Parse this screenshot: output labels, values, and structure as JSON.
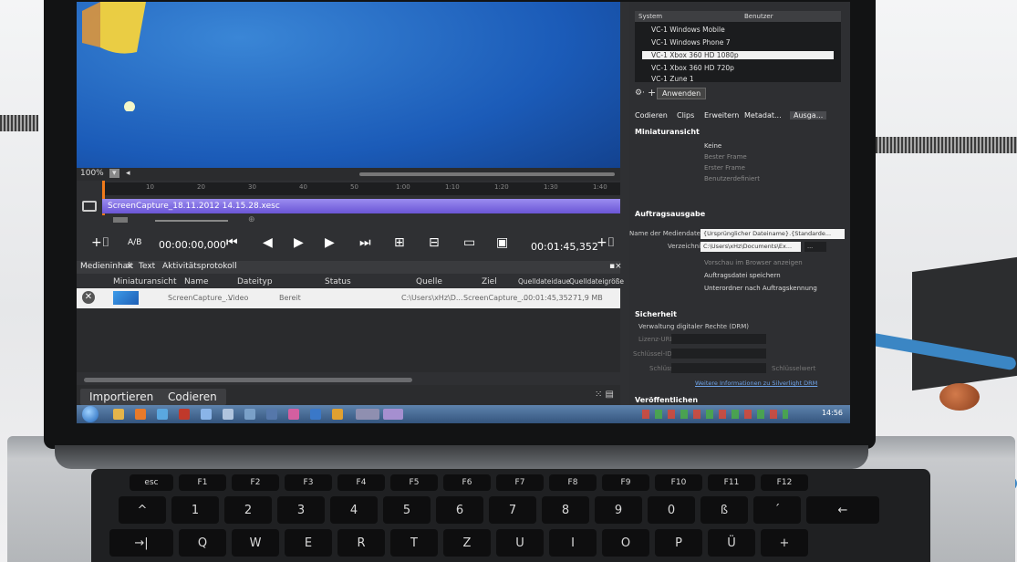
{
  "preview": {
    "zoom": "100%"
  },
  "timeline": {
    "ruler_ticks": [
      "10",
      "20",
      "30",
      "40",
      "50",
      "1:00",
      "1:10",
      "1:20",
      "1:30",
      "1:40"
    ],
    "clip_name": "ScreenCapture_18.11.2012 14.15.28.xesc"
  },
  "transport": {
    "ab_label": "A/B",
    "current_time": "00:00:00,000",
    "duration": "00:01:45,352"
  },
  "tabs": {
    "media": "Medieninhalt",
    "text": "Text",
    "activity": "Aktivitätsprotokoll"
  },
  "grid": {
    "headers": [
      "Miniaturansicht",
      "Name",
      "Dateityp",
      "Status",
      "Quelle",
      "Ziel",
      "Quelldateidaue",
      "Quelldateigröße"
    ],
    "row": [
      "ScreenCapture_...",
      "Video",
      "Bereit",
      "C:\\Users\\xHz\\D...",
      "ScreenCapture_...",
      "00:01:45,352",
      "71,9 MB"
    ]
  },
  "footer": {
    "import": "Importieren",
    "encode": "Codieren"
  },
  "presets": {
    "col_system": "System",
    "col_user": "Benutzer",
    "items": [
      "VC-1 Windows Mobile",
      "VC-1 Windows Phone 7",
      "VC-1 Xbox 360 HD 1080p",
      "VC-1 Xbox 360 HD 720p",
      "VC-1 Zune 1"
    ],
    "selected_index": 2,
    "apply": "Anwenden"
  },
  "right_tabs": [
    "Codieren",
    "Clips",
    "Erweitern",
    "Metadat...",
    "Ausga..."
  ],
  "thumbnail": {
    "title": "Miniaturansicht",
    "options": [
      "Keine",
      "Bester Frame",
      "Erster Frame",
      "Benutzerdefiniert"
    ]
  },
  "job_output": {
    "title": "Auftragsausgabe",
    "media_file_label": "Name der Mediendatei",
    "media_file_value": "{Ursprünglicher Dateiname}.{Standarde...",
    "dir_label": "Verzeichnis",
    "dir_value": "C:\\Users\\xHz\\Documents\\Ex...",
    "browse": "...",
    "check1": "Vorschau im Browser anzeigen",
    "check2": "Auftragsdatei speichern",
    "check3": "Unterordner nach Auftragskennung"
  },
  "security": {
    "title": "Sicherheit",
    "drm": "Verwaltung digitaler Rechte (DRM)",
    "license_url": "Lizenz-URL",
    "key_id": "Schlüssel-ID",
    "key": "Schlüssel",
    "key_btn": "Schlüsselwert",
    "more_info": "Weitere Informationen zu Silverlight DRM"
  },
  "publish": {
    "title": "Veröffentlichen"
  },
  "taskbar": {
    "clock": "14:56"
  },
  "keyboard": {
    "row1": [
      "esc",
      "F1",
      "F2",
      "F3",
      "F4",
      "F5",
      "F6",
      "F7",
      "F8",
      "F9",
      "F10",
      "F11",
      "F12"
    ],
    "row2": [
      "^",
      "1",
      "2",
      "3",
      "4",
      "5",
      "6",
      "7",
      "8",
      "9",
      "0",
      "ß",
      "´",
      "←"
    ],
    "row3": [
      "→|",
      "Q",
      "W",
      "E",
      "R",
      "T",
      "Z",
      "U",
      "I",
      "O",
      "P",
      "Ü",
      "+"
    ]
  },
  "colors": {
    "accent": "#6a55d6",
    "desktop_blue": "#1b5bb8",
    "cable_blue": "#3b86c4"
  }
}
